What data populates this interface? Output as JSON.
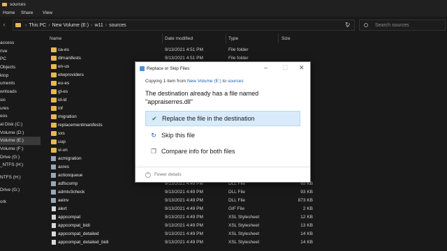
{
  "window": {
    "title": "sources"
  },
  "ribbon": {
    "tabs": [
      "Home",
      "Share",
      "View"
    ]
  },
  "address": {
    "crumbs": [
      "This PC",
      "New Volume (E:)",
      "w11",
      "sources"
    ]
  },
  "search": {
    "placeholder": "Search sources"
  },
  "columns": {
    "name": "Name",
    "date": "Date modified",
    "type": "Type",
    "size": "Size"
  },
  "sidebar": {
    "items": [
      "access",
      "rive",
      "PC",
      "Objects",
      "ktop",
      "uments",
      "wnloads",
      "sic",
      "ures",
      "eos",
      "al Disk (C:)",
      "Volume (D:)",
      "Volume (E:)",
      "Volume (F:)",
      "Drive (G:)",
      "_NTFS (H:)",
      "NTFS (H:)",
      "Drive (G:)",
      "ork"
    ],
    "selected_index": 12
  },
  "files": [
    {
      "name": "ca-es",
      "date": "9/13/2021 4:51 PM",
      "type": "File folder",
      "size": "",
      "icon": "folder"
    },
    {
      "name": "dlmanifests",
      "date": "9/13/2021 4:51 PM",
      "type": "File folder",
      "size": "",
      "icon": "folder"
    },
    {
      "name": "en-us",
      "date": "",
      "type": "",
      "size": "",
      "icon": "folder"
    },
    {
      "name": "etwproviders",
      "date": "",
      "type": "",
      "size": "",
      "icon": "folder"
    },
    {
      "name": "eu-es",
      "date": "",
      "type": "",
      "size": "",
      "icon": "folder"
    },
    {
      "name": "gl-es",
      "date": "",
      "type": "",
      "size": "",
      "icon": "folder"
    },
    {
      "name": "id-id",
      "date": "",
      "type": "",
      "size": "",
      "icon": "folder"
    },
    {
      "name": "inf",
      "date": "",
      "type": "",
      "size": "",
      "icon": "folder"
    },
    {
      "name": "migration",
      "date": "",
      "type": "",
      "size": "",
      "icon": "folder"
    },
    {
      "name": "replacementmanifests",
      "date": "",
      "type": "",
      "size": "",
      "icon": "folder"
    },
    {
      "name": "sxs",
      "date": "",
      "type": "",
      "size": "",
      "icon": "folder"
    },
    {
      "name": "uup",
      "date": "",
      "type": "",
      "size": "",
      "icon": "folder"
    },
    {
      "name": "vi-vn",
      "date": "",
      "type": "",
      "size": "",
      "icon": "folder"
    },
    {
      "name": "acmigration",
      "date": "",
      "type": "",
      "size": "",
      "icon": "dll"
    },
    {
      "name": "acres",
      "date": "",
      "type": "",
      "size": "",
      "icon": "dll"
    },
    {
      "name": "actionqueue",
      "date": "",
      "type": "",
      "size": "",
      "icon": "dll"
    },
    {
      "name": "adfscomp",
      "date": "9/13/2021 4:49 PM",
      "type": "DLL File",
      "size": "65 KB",
      "icon": "dll"
    },
    {
      "name": "admtv3check",
      "date": "9/13/2021 4:49 PM",
      "type": "DLL File",
      "size": "93 KB",
      "icon": "dll"
    },
    {
      "name": "aeinv",
      "date": "9/13/2021 4:49 PM",
      "type": "DLL File",
      "size": "873 KB",
      "icon": "dll"
    },
    {
      "name": "alert",
      "date": "9/13/2021 4:49 PM",
      "type": "GIF File",
      "size": "2 KB",
      "icon": "file"
    },
    {
      "name": "appcompat",
      "date": "9/13/2021 4:49 PM",
      "type": "XSL Stylesheet",
      "size": "12 KB",
      "icon": "file"
    },
    {
      "name": "appcompat_bidi",
      "date": "9/13/2021 4:49 PM",
      "type": "XSL Stylesheet",
      "size": "13 KB",
      "icon": "file"
    },
    {
      "name": "appcompat_detailed",
      "date": "9/13/2021 4:49 PM",
      "type": "XSL Stylesheet",
      "size": "14 KB",
      "icon": "file"
    },
    {
      "name": "appcompat_detailed_bidi",
      "date": "9/13/2021 4:49 PM",
      "type": "XSL Stylesheet",
      "size": "14 KB",
      "icon": "file"
    }
  ],
  "dialog": {
    "title": "Replace or Skip Files",
    "copying_prefix": "Copying 1 item from",
    "from": "New Volume (E:)",
    "to_word": "to",
    "dest": "sources",
    "headline": "The destination already has a file named \"appraiserres.dll\"",
    "option_replace": "Replace the file in the destination",
    "option_skip": "Skip this file",
    "option_compare": "Compare info for both files",
    "fewer": "Fewer details"
  }
}
